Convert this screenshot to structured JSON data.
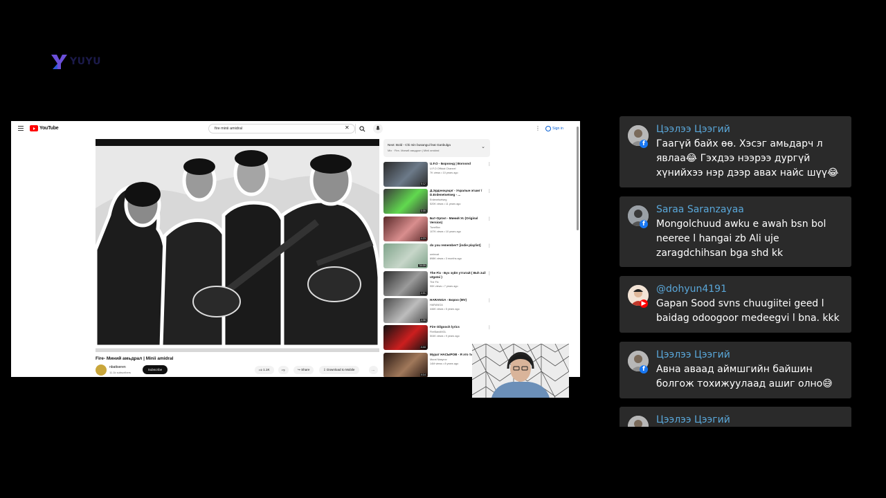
{
  "brand": {
    "name": "YUYU"
  },
  "youtube": {
    "logo_text": "YouTube",
    "search_value": "fire minii amidral",
    "signin_label": "Sign in",
    "video": {
      "title": "Fire- Миний амьдрал | Minii amidral",
      "channel": "nbattseren",
      "subscribers": "11.1k subscribers",
      "subscribe_label": "Subscribe",
      "likes": "1.1K",
      "share_label": "Share",
      "download_label": "Download to Mobile"
    },
    "up_next": {
      "title": "Next: Bold - Chi min busangui feat Ganbulga",
      "subtitle": "Mix · Fire- Миний амьдрал | Minii amidral"
    },
    "recommendations": [
      {
        "title": "U.F.O - Бороонд | Boroond",
        "channel": "U.F.O Official Channel",
        "meta": "7K views • 10 years ago",
        "duration": "5:12"
      },
      {
        "title": "Д.Эрдэнэцэцэг - Учралын эгшиг / D.Erdenetsetseg - ...",
        "channel": "Erdenetsetseg",
        "meta": "520K views • 11 years ago",
        "duration": "5:05"
      },
      {
        "title": "Бат-Оргил - Миний Ус (Original Version)",
        "channel": "TuneBox",
        "meta": "107K views • 10 years ago",
        "duration": "4:23"
      },
      {
        "title": "do you remember? [indie playlist]",
        "channel": "umincat",
        "meta": "898K views • 3 months ago",
        "duration": "34:09"
      },
      {
        "title": "The Fix - Бух зүйл утгатай ( Buh zuil utgatai )",
        "channel": "The Fix",
        "meta": "90K views • 7 years ago",
        "duration": "4:01"
      },
      {
        "title": "HARANGA - Бороо (MV)",
        "channel": "HARANGA",
        "meta": "446K views • 5 years ago",
        "duration": "4:08"
      },
      {
        "title": "Fire Oilgooch lyrics",
        "channel": "FireBandMGL",
        "meta": "504K views • 9 years ago",
        "duration": "4:44"
      },
      {
        "title": "Мурат НАСЫРОВ - Я это ты",
        "channel": "Murat Nasyrov",
        "meta": "14M views • 8 years ago",
        "duration": "4:14"
      }
    ]
  },
  "chat": {
    "messages": [
      {
        "author": "Цээлээ Цээгий",
        "platform": "facebook",
        "text": "Гаагүй байх өө. Хэсэг амьдарч л явлаа😂 Гэхдээ нээрээ дургүй хүнийхээ нэр дээр авах найс шүү😂"
      },
      {
        "author": "Saraa Saranzayaa",
        "platform": "facebook",
        "text": "Mongolchuud awku e awah bsn bol neeree l hangai zb Ali uje zaragdchihsan bga shd kk"
      },
      {
        "author": "@dohyun4191",
        "platform": "youtube",
        "text": "Gapan Sood svns chuugiitei geed l baidag odoogoor medeegvi l bna. kkk"
      },
      {
        "author": "Цээлээ Цээгий",
        "platform": "facebook",
        "text": "Авна аваад аймшгийн байшин болгож тохижуулаад ашиг олно😅"
      },
      {
        "author": "Цээлээ Цээгий",
        "platform": "facebook",
        "text": ""
      }
    ]
  },
  "colors": {
    "chat_name": "#5aa7d9",
    "card_bg": "#2a2a2a",
    "facebook": "#1877f2",
    "youtube": "#ff0000"
  },
  "icons": [
    "menu-icon",
    "youtube-logo-icon",
    "search-icon",
    "close-icon",
    "mic-icon",
    "more-icon",
    "account-icon",
    "like-icon",
    "dislike-icon",
    "share-icon",
    "download-icon",
    "chevron-down-icon",
    "facebook-icon",
    "youtube-icon"
  ]
}
